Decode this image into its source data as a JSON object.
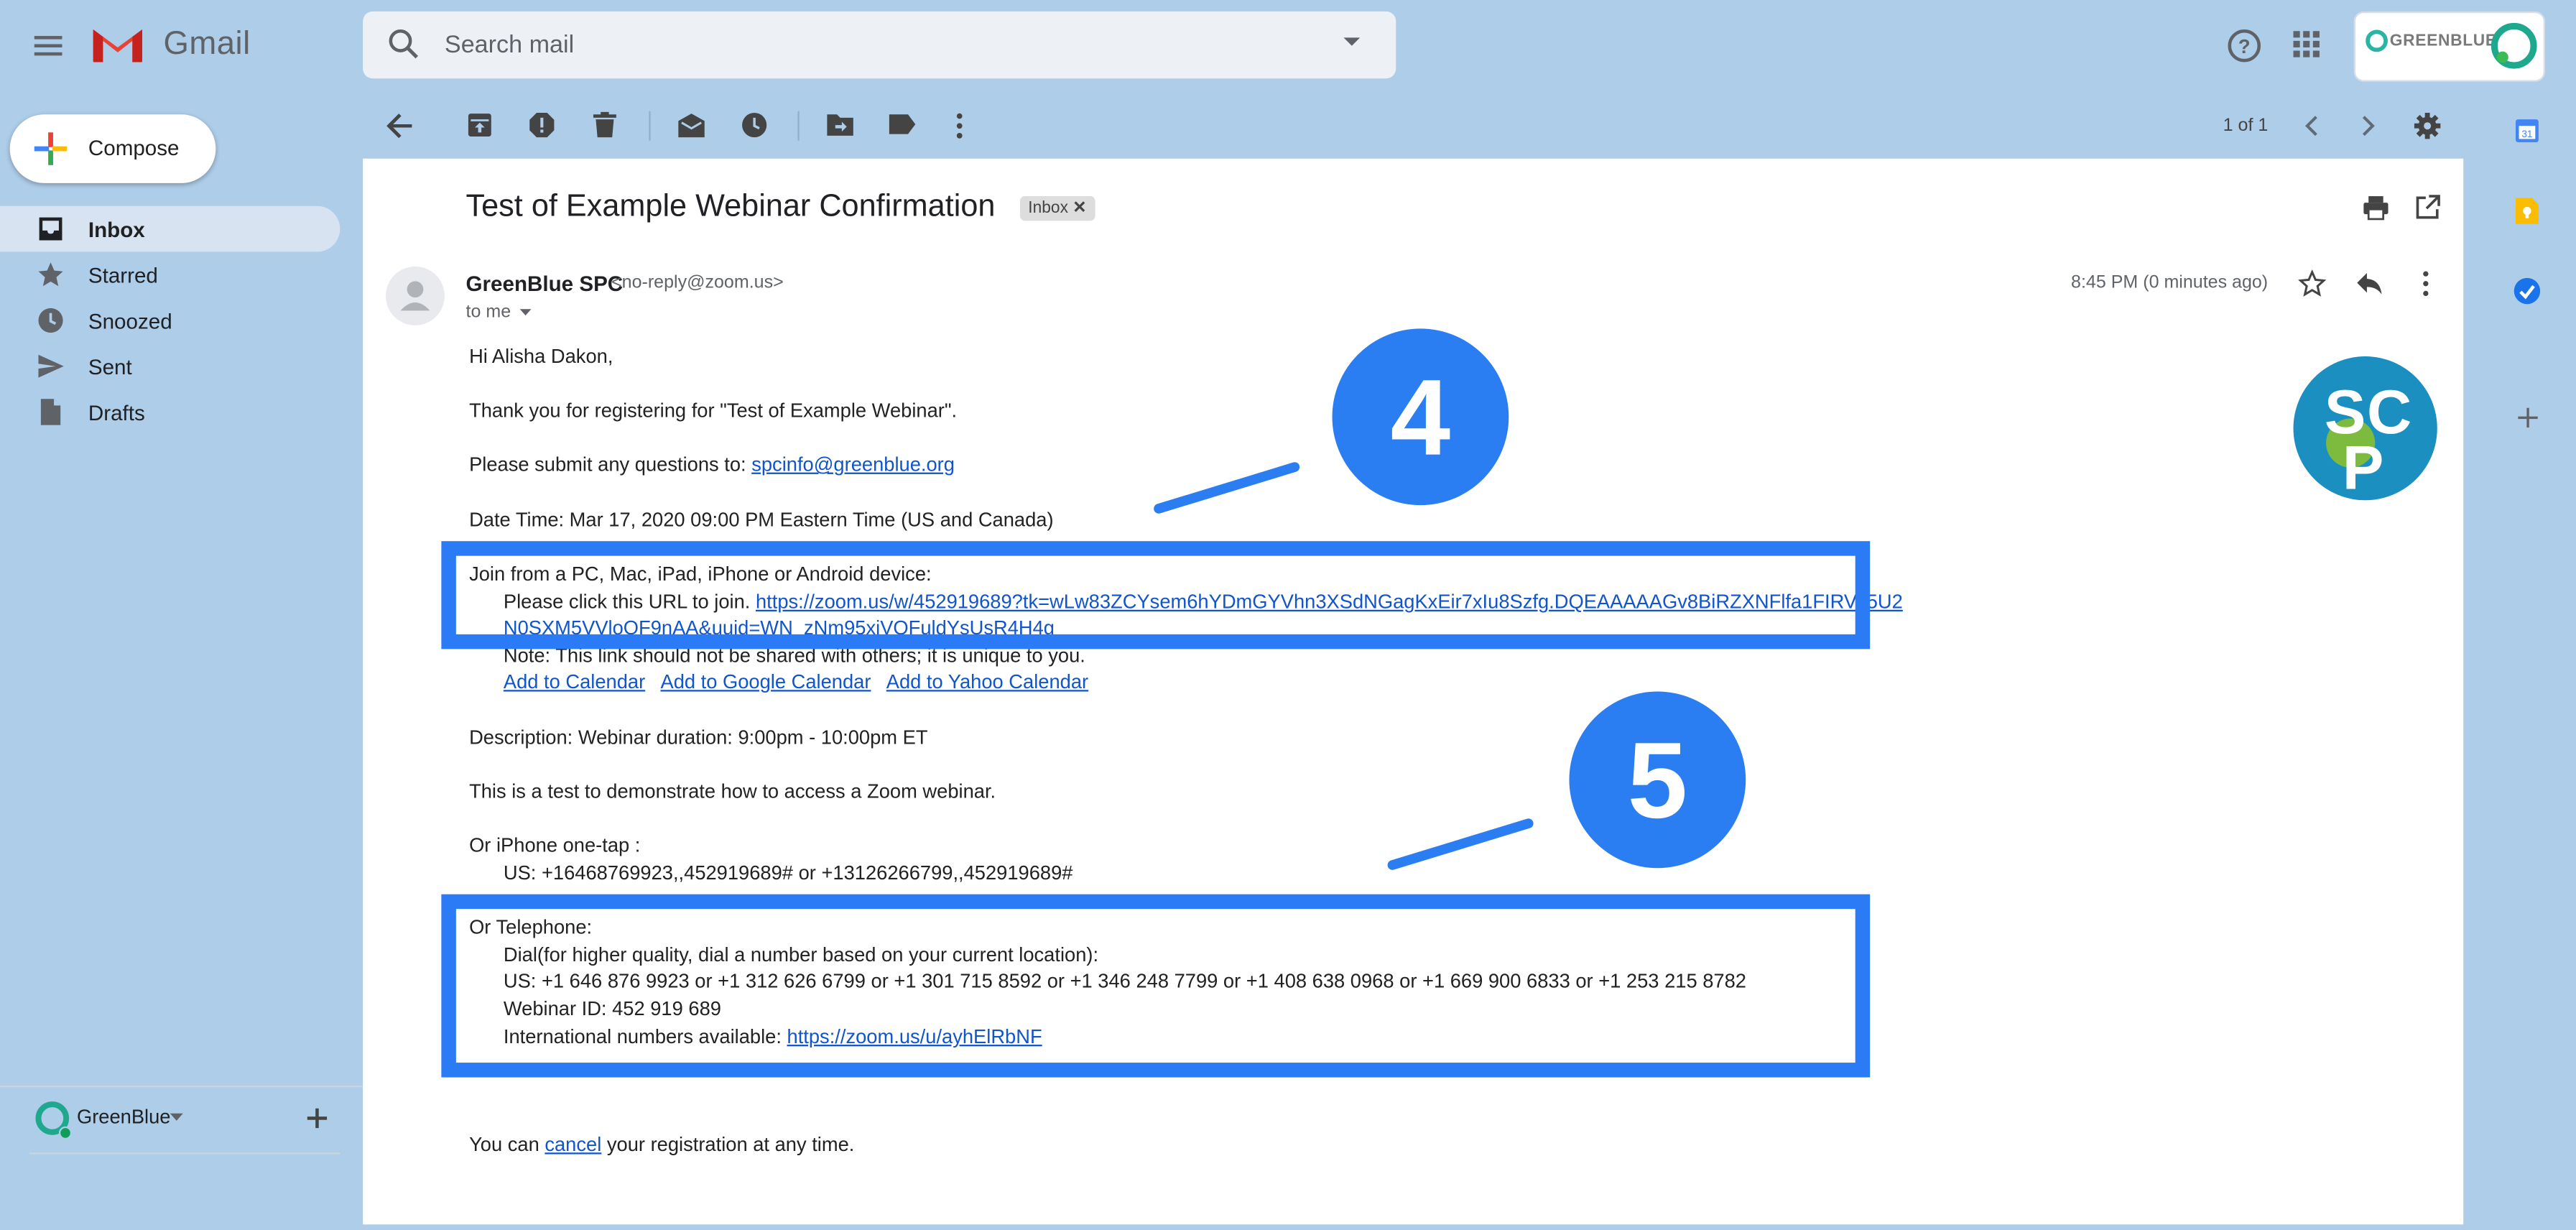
{
  "app": {
    "name": "Gmail"
  },
  "search": {
    "placeholder": "Search mail"
  },
  "account": {
    "brand": "GREENBLUE"
  },
  "compose": {
    "label": "Compose"
  },
  "nav": [
    {
      "label": "Inbox",
      "icon": "inbox-icon",
      "active": true
    },
    {
      "label": "Starred",
      "icon": "star-icon"
    },
    {
      "label": "Snoozed",
      "icon": "clock-icon"
    },
    {
      "label": "Sent",
      "icon": "send-icon"
    },
    {
      "label": "Drafts",
      "icon": "draft-icon"
    }
  ],
  "hangouts": {
    "user": "GreenBlue"
  },
  "toolbar": {
    "pager": "1 of 1"
  },
  "email": {
    "subject": "Test of Example Webinar Confirmation",
    "label": "Inbox",
    "sender_name": "GreenBlue SPC",
    "sender_email": "<no-reply@zoom.us>",
    "to": "to me",
    "time": "8:45 PM (0 minutes ago)",
    "greeting": "Hi Alisha Dakon,",
    "thanks": "Thank you for registering for \"Test of Example Webinar\".",
    "questions_prefix": "Please submit any questions to: ",
    "questions_email": "spcinfo@greenblue.org",
    "datetime": "Date Time: Mar 17, 2020 09:00 PM Eastern Time (US and Canada)",
    "join_heading": "Join from a PC, Mac, iPad, iPhone or Android device:",
    "join_prefix": "Please click this URL to join. ",
    "join_url_line1": "https://zoom.us/w/452919689?tk=wLw83ZCYsem6hYDmGYVhn3XSdNGagKxEir7xIu8Szfg.DQEAAAAAGv8BiRZXNFlfa1FIRVJ5U2",
    "join_url_line2": "N0SXM5VVloOF9nAA&uuid=WN_zNm95xjVQFuldYsUsR4H4g",
    "note": "Note: This link should not be shared with others; it is unique to you.",
    "cal_links": [
      "Add to Calendar",
      "Add to Google Calendar",
      "Add to Yahoo Calendar"
    ],
    "description": "Description: Webinar duration: 9:00pm - 10:00pm ET",
    "test_text": "This is a test to demonstrate how to access a Zoom webinar.",
    "iphone_heading": "Or iPhone one-tap :",
    "iphone_numbers": "US: +16468769923,,452919689# or +13126266799,,452919689#",
    "tel_heading": "Or Telephone:",
    "tel_dial": "Dial(for higher quality, dial a number based on your current location):",
    "tel_us": "US: +1 646 876 9923 or +1 312 626 6799 or +1 301 715 8592 or +1 346 248 7799 or +1 408 638 0968 or +1 669 900 6833 or +1 253 215 8782",
    "webinar_id": "Webinar ID: 452 919 689",
    "intl_prefix": "International numbers available: ",
    "intl_url": "https://zoom.us/u/ayhElRbNF",
    "cancel_prefix": "You can ",
    "cancel_link": "cancel",
    "cancel_suffix": " your registration at any time."
  },
  "annotations": [
    {
      "label": "4",
      "color": "#2b7ef2"
    },
    {
      "label": "5",
      "color": "#2b7ef2"
    }
  ]
}
